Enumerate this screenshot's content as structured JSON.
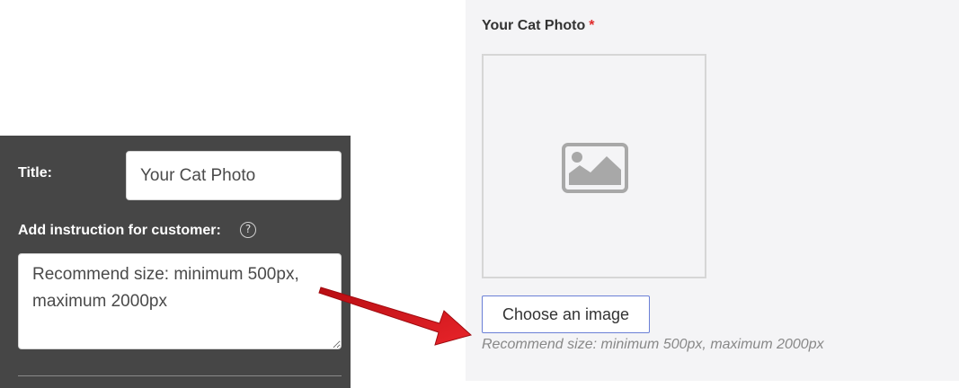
{
  "admin": {
    "title_label": "Title:",
    "title_value": "Your Cat Photo",
    "instruction_label": "Add instruction for customer:",
    "help_icon": "question-circle-icon",
    "instruction_value": "Recommend size: minimum 500px, maximum 2000px"
  },
  "preview": {
    "field_label": "Your Cat Photo",
    "required_marker": "*",
    "placeholder_icon": "image-icon",
    "choose_button_label": "Choose an image",
    "hint": "Recommend size: minimum 500px, maximum 2000px"
  },
  "colors": {
    "admin_background": "#464646",
    "preview_background": "#f4f4f6",
    "required_star": "#e02b2b",
    "button_border": "#6a7fd6",
    "annotation_arrow": "#d8141b"
  },
  "annotation": {
    "icon": "red-arrow-icon"
  }
}
